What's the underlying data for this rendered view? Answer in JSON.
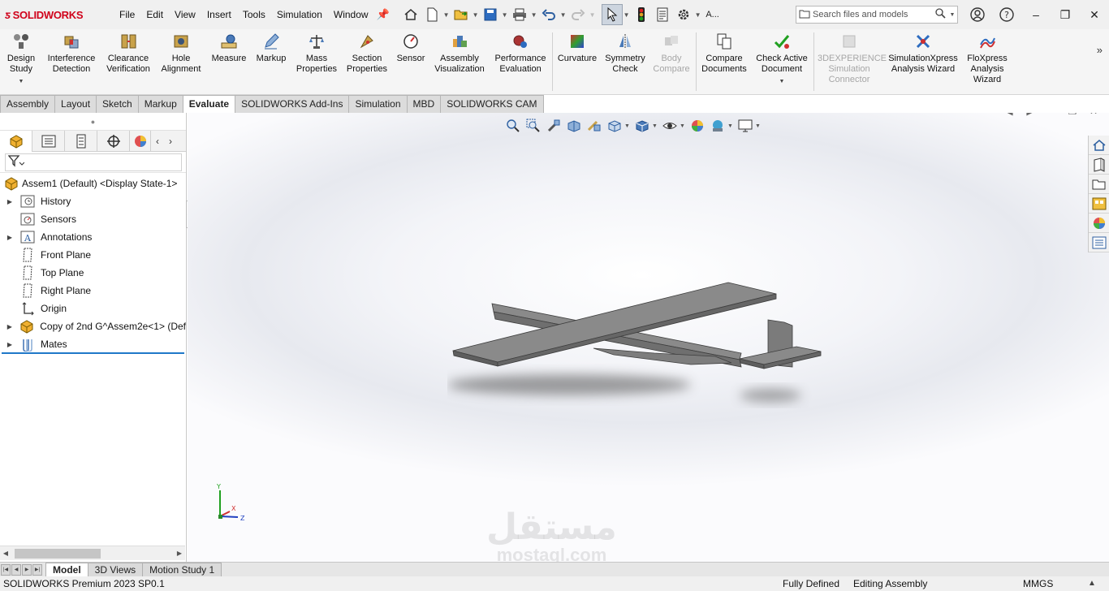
{
  "app": {
    "logo_text": "SOLIDWORKS"
  },
  "menu": [
    "File",
    "Edit",
    "View",
    "Insert",
    "Tools",
    "Simulation",
    "Window"
  ],
  "quick_access": {
    "overflow_label": "A..."
  },
  "search": {
    "placeholder": "Search files and models"
  },
  "ribbon": {
    "design_study": "Design Study",
    "interference": "Interference Detection",
    "clearance": "Clearance Verification",
    "hole_alignment": "Hole Alignment",
    "measure": "Measure",
    "markup": "Markup",
    "mass_properties": "Mass Properties",
    "section_properties": "Section Properties",
    "sensor": "Sensor",
    "assembly_visualization": "Assembly Visualization",
    "performance_evaluation": "Performance Evaluation",
    "curvature": "Curvature",
    "symmetry_check": "Symmetry Check",
    "body_compare": "Body Compare",
    "compare_documents": "Compare Documents",
    "check_active_document": "Check Active Document",
    "simulation_connector": "3DEXPERIENCE Simulation Connector",
    "simulationxpress": "SimulationXpress Analysis Wizard",
    "floxpress": "FloXpress Analysis Wizard"
  },
  "tabs": [
    "Assembly",
    "Layout",
    "Sketch",
    "Markup",
    "Evaluate",
    "SOLIDWORKS Add-Ins",
    "Simulation",
    "MBD",
    "SOLIDWORKS CAM"
  ],
  "active_tab": "Evaluate",
  "feature_tree": {
    "root": "Assem1 (Default) <Display State-1>",
    "items": [
      {
        "label": "History",
        "icon": "history-folder-icon",
        "expandable": true
      },
      {
        "label": "Sensors",
        "icon": "sensors-folder-icon",
        "expandable": false
      },
      {
        "label": "Annotations",
        "icon": "annotations-folder-icon",
        "expandable": true
      },
      {
        "label": "Front Plane",
        "icon": "plane-icon",
        "expandable": false
      },
      {
        "label": "Top Plane",
        "icon": "plane-icon",
        "expandable": false
      },
      {
        "label": "Right Plane",
        "icon": "plane-icon",
        "expandable": false
      },
      {
        "label": "Origin",
        "icon": "origin-icon",
        "expandable": false
      },
      {
        "label": "Copy of 2nd G^Assem2e<1> (Def",
        "icon": "subassembly-icon",
        "expandable": true
      },
      {
        "label": "Mates",
        "icon": "mates-icon",
        "expandable": true
      }
    ]
  },
  "triad": {
    "y": "Y",
    "x": "X",
    "z": "Z"
  },
  "watermark": {
    "arabic": "مستقل",
    "latin": "mostaql.com"
  },
  "bottom_tabs": [
    "Model",
    "3D Views",
    "Motion Study 1"
  ],
  "active_bottom_tab": "Model",
  "status": {
    "product": "SOLIDWORKS Premium 2023 SP0.1",
    "defined": "Fully Defined",
    "mode": "Editing Assembly",
    "units": "MMGS"
  },
  "colors": {
    "accent": "#1f78c8",
    "brand": "#d0021b",
    "model_gray": "#7a7a7a"
  }
}
